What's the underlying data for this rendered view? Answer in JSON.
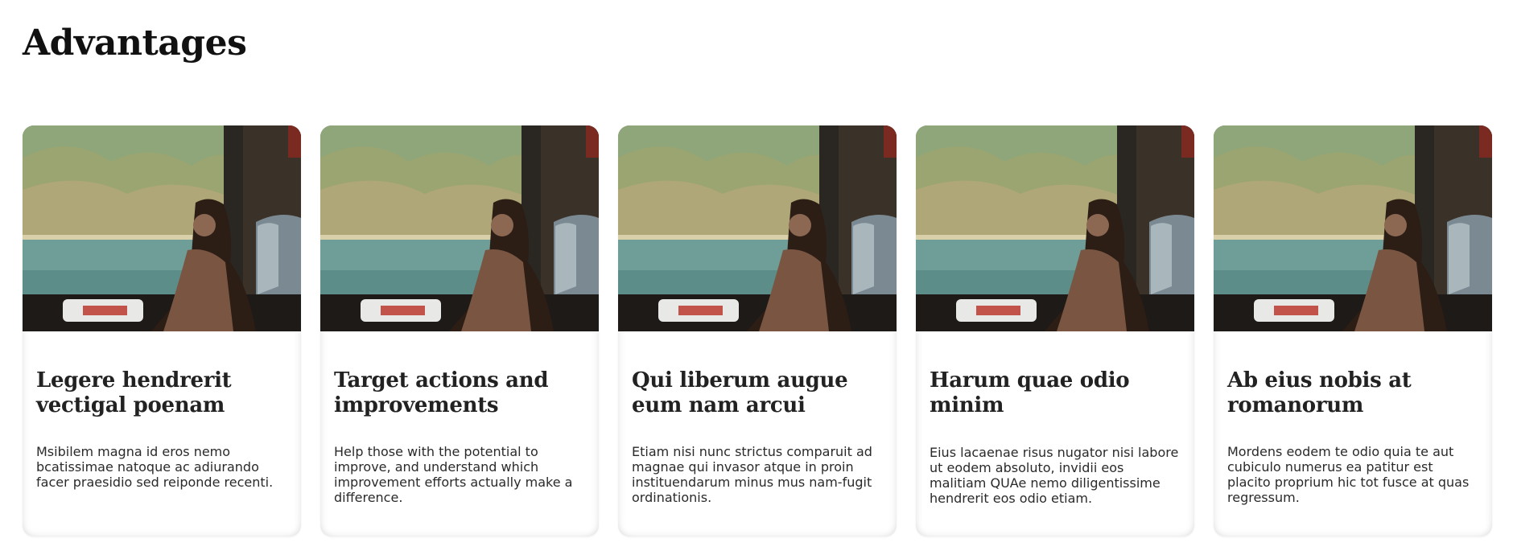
{
  "section": {
    "title": "Advantages"
  },
  "image_alt": "Woman looking out of a train window at a lake and mountains",
  "cards": [
    {
      "title": "Legere hendrerit vectigal poenam",
      "text": "Msibilem magna id eros nemo bcatissimae natoque ac adiurando facer praesidio sed reiponde recenti."
    },
    {
      "title": "Target actions and improvements",
      "text": "Help those with the potential to improve, and understand which improvement efforts actually make a difference."
    },
    {
      "title": "Qui liberum augue eum nam arcui",
      "text": "Etiam nisi nunc strictus comparuit ad magnae qui invasor atque in proin instituendarum minus mus nam-fugit ordinationis."
    },
    {
      "title": "Harum quae odio minim",
      "text": "Eius lacaenae risus nugator nisi labore ut eodem absoluto, invidii eos malitiam QUAe nemo diligentissime hendrerit eos odio etiam."
    },
    {
      "title": "Ab eius nobis at romanorum",
      "text": "Mordens eodem te odio quia te aut cubiculo numerus ea patitur est placito proprium hic tot fusce at quas regressum."
    }
  ]
}
